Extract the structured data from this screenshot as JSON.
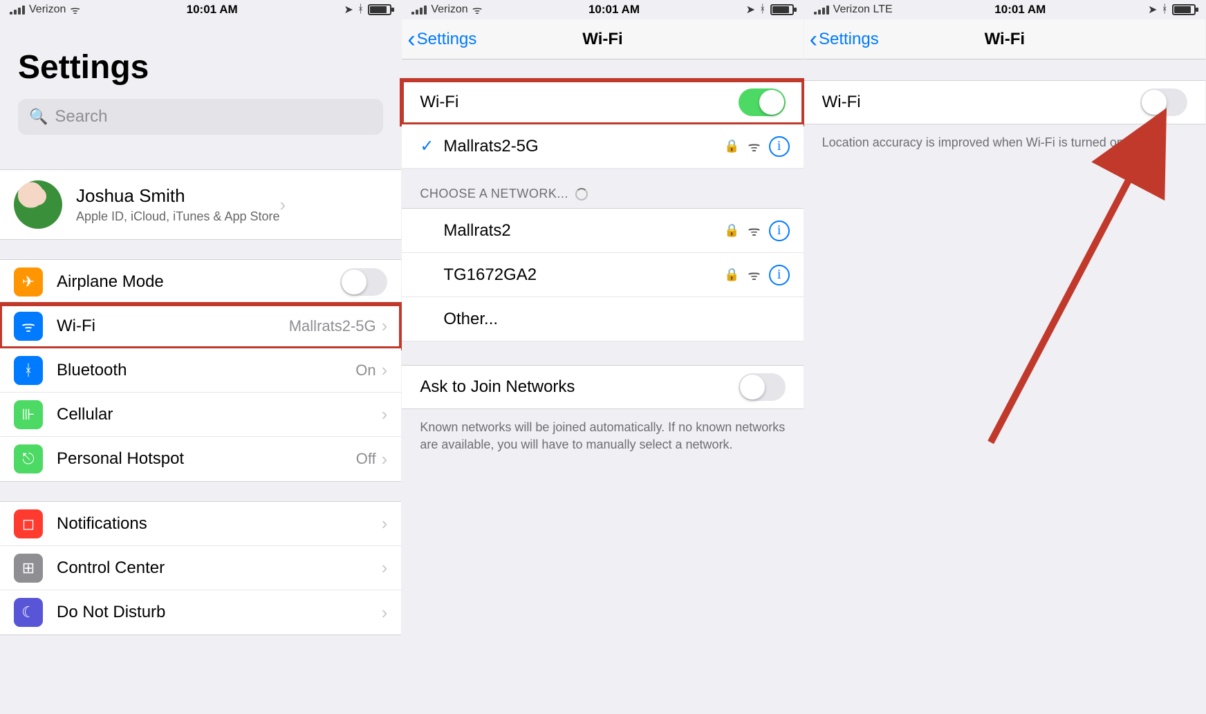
{
  "panel1": {
    "status": {
      "carrier": "Verizon",
      "network_glyph": "wifi",
      "time": "10:01 AM"
    },
    "title": "Settings",
    "search_placeholder": "Search",
    "profile": {
      "name": "Joshua Smith",
      "subtitle": "Apple ID, iCloud, iTunes & App Store"
    },
    "rows_net": [
      {
        "icon": "airplane",
        "label": "Airplane Mode",
        "type": "toggle",
        "on": false
      },
      {
        "icon": "wifi",
        "label": "Wi-Fi",
        "detail": "Mallrats2-5G",
        "type": "nav",
        "highlight": true
      },
      {
        "icon": "bt",
        "label": "Bluetooth",
        "detail": "On",
        "type": "nav"
      },
      {
        "icon": "cell",
        "label": "Cellular",
        "type": "nav"
      },
      {
        "icon": "hotspot",
        "label": "Personal Hotspot",
        "detail": "Off",
        "type": "nav"
      }
    ],
    "rows_sys": [
      {
        "icon": "notif",
        "label": "Notifications",
        "type": "nav"
      },
      {
        "icon": "cc",
        "label": "Control Center",
        "type": "nav"
      },
      {
        "icon": "dnd",
        "label": "Do Not Disturb",
        "type": "nav"
      }
    ]
  },
  "panel2": {
    "status": {
      "carrier": "Verizon",
      "network_glyph": "wifi",
      "time": "10:01 AM"
    },
    "nav_back": "Settings",
    "nav_title": "Wi-Fi",
    "wifi_toggle": {
      "label": "Wi-Fi",
      "on": true,
      "highlight": true
    },
    "connected": {
      "name": "Mallrats2-5G",
      "locked": true
    },
    "choose_header": "CHOOSE A NETWORK...",
    "networks": [
      {
        "name": "Mallrats2",
        "locked": true
      },
      {
        "name": "TG1672GA2",
        "locked": true
      },
      {
        "name": "Other...",
        "locked": false,
        "other": true
      }
    ],
    "ask_join": {
      "label": "Ask to Join Networks",
      "on": false
    },
    "footer": "Known networks will be joined automatically. If no known networks are available, you will have to manually select a network."
  },
  "panel3": {
    "status": {
      "carrier": "Verizon  LTE",
      "network_glyph": "none",
      "time": "10:01 AM"
    },
    "nav_back": "Settings",
    "nav_title": "Wi-Fi",
    "wifi_toggle": {
      "label": "Wi-Fi",
      "on": false
    },
    "note": "Location accuracy is improved when Wi-Fi is turned on."
  },
  "icons": {
    "airplane": "✈",
    "wifi": "ᯤ",
    "bt": "ᚼ",
    "cell": "⊪",
    "hotspot": "⎋",
    "notif": "◻",
    "cc": "⊞",
    "dnd": "☾"
  }
}
